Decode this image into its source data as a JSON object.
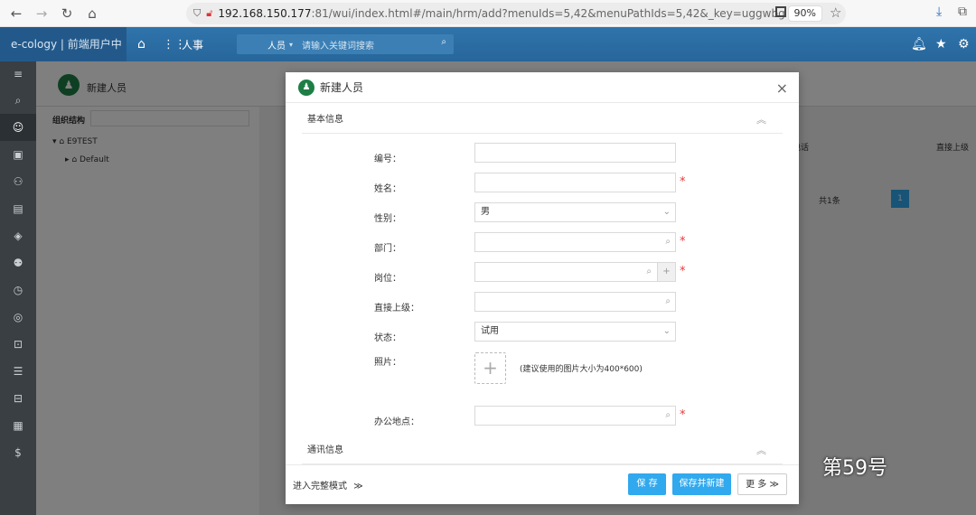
{
  "browser": {
    "url_host": "192.168.150.177",
    "url_rest": ":81/wui/index.html#/main/hrm/add?menuIds=5,42&menuPathIds=5,42&_key=uggwbg",
    "zoom": "90%"
  },
  "app": {
    "brand": "e-cology | 前端用户中心",
    "module": "人事",
    "search_scope": "人员",
    "search_placeholder": "请输入关键词搜索"
  },
  "background": {
    "page_title": "新建人员",
    "tree_label": "组织结构",
    "tree_root": "E9TEST",
    "tree_child": "Default",
    "col_phone": "办公室电话",
    "col_superior": "直接上级",
    "total": "共1条",
    "page_num": "1"
  },
  "modal": {
    "title": "新建人员",
    "section_basic": "基本信息",
    "section_contact": "通讯信息",
    "fields": {
      "code": {
        "label": "编号："
      },
      "name": {
        "label": "姓名："
      },
      "gender": {
        "label": "性别：",
        "value": "男"
      },
      "dept": {
        "label": "部门："
      },
      "position": {
        "label": "岗位："
      },
      "superior": {
        "label": "直接上级："
      },
      "status": {
        "label": "状态：",
        "value": "试用"
      },
      "photo": {
        "label": "照片：",
        "hint": "(建议使用的图片大小为400*600)"
      },
      "office": {
        "label": "办公地点："
      }
    },
    "footer": {
      "full_mode": "进入完整模式",
      "save": "保 存",
      "save_new": "保存并新建",
      "more": "更 多"
    }
  },
  "watermark": "第59号"
}
